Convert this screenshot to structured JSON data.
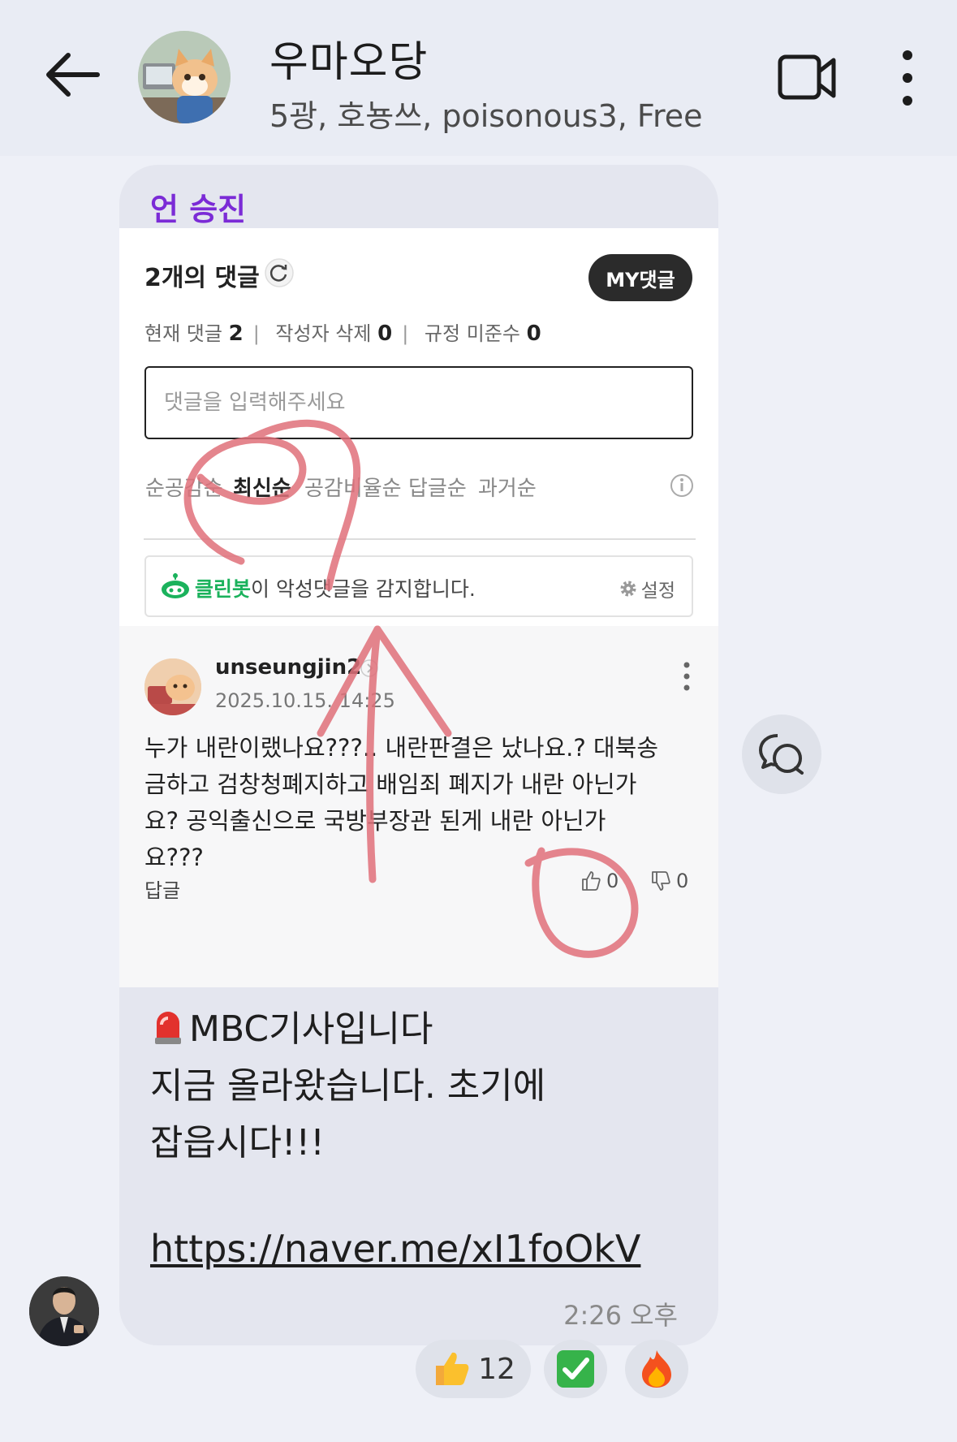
{
  "header": {
    "title": "우마오당",
    "members": "5광, 호뇽쓰, poisonous3, Free"
  },
  "message": {
    "sender": "언 승진",
    "screenshot": {
      "comment_count_title": "2개의 댓글",
      "my_comments_label": "MY댓글",
      "stats": {
        "current_label": "현재 댓글",
        "current_value": "2",
        "deleted_label": "작성자 삭제",
        "deleted_value": "0",
        "violation_label": "규정 미준수",
        "violation_value": "0"
      },
      "input_placeholder": "댓글을 입력해주세요",
      "sort_tabs": [
        "순공감순",
        "최신순",
        "공감비율순",
        "답글순",
        "과거순"
      ],
      "active_sort": "최신순",
      "cleanbot": {
        "brand": "클린봇",
        "text": "이 악성댓글을 감지합니다.",
        "settings_label": "설정"
      },
      "comment": {
        "username": "unseungjin2",
        "date": "2025.10.15. 14:25",
        "body": "누가 내란이랬나요???.. 내란판결은 났나요.? 대북송금하고 검창청폐지하고 배임죄 폐지가 내란 아닌가요? 공익출신으로 국방부장관 된게 내란 아닌가요???",
        "reply_label": "답글",
        "likes": "0",
        "dislikes": "0"
      }
    },
    "text_lines": [
      "MBC기사입니다",
      "지금 올라왔습니다. 초기에",
      "잡읍시다!!!"
    ],
    "link": "https://naver.me/xI1foOkV",
    "time": "2:26 오후"
  },
  "reactions": [
    {
      "emoji": "thumbs-up",
      "count": "12"
    },
    {
      "emoji": "check-mark"
    },
    {
      "emoji": "fire"
    }
  ],
  "colors": {
    "sender_name": "#7b2bd6",
    "cleanbot_green": "#1bb25c",
    "annotation_pen": "#e0707a"
  }
}
